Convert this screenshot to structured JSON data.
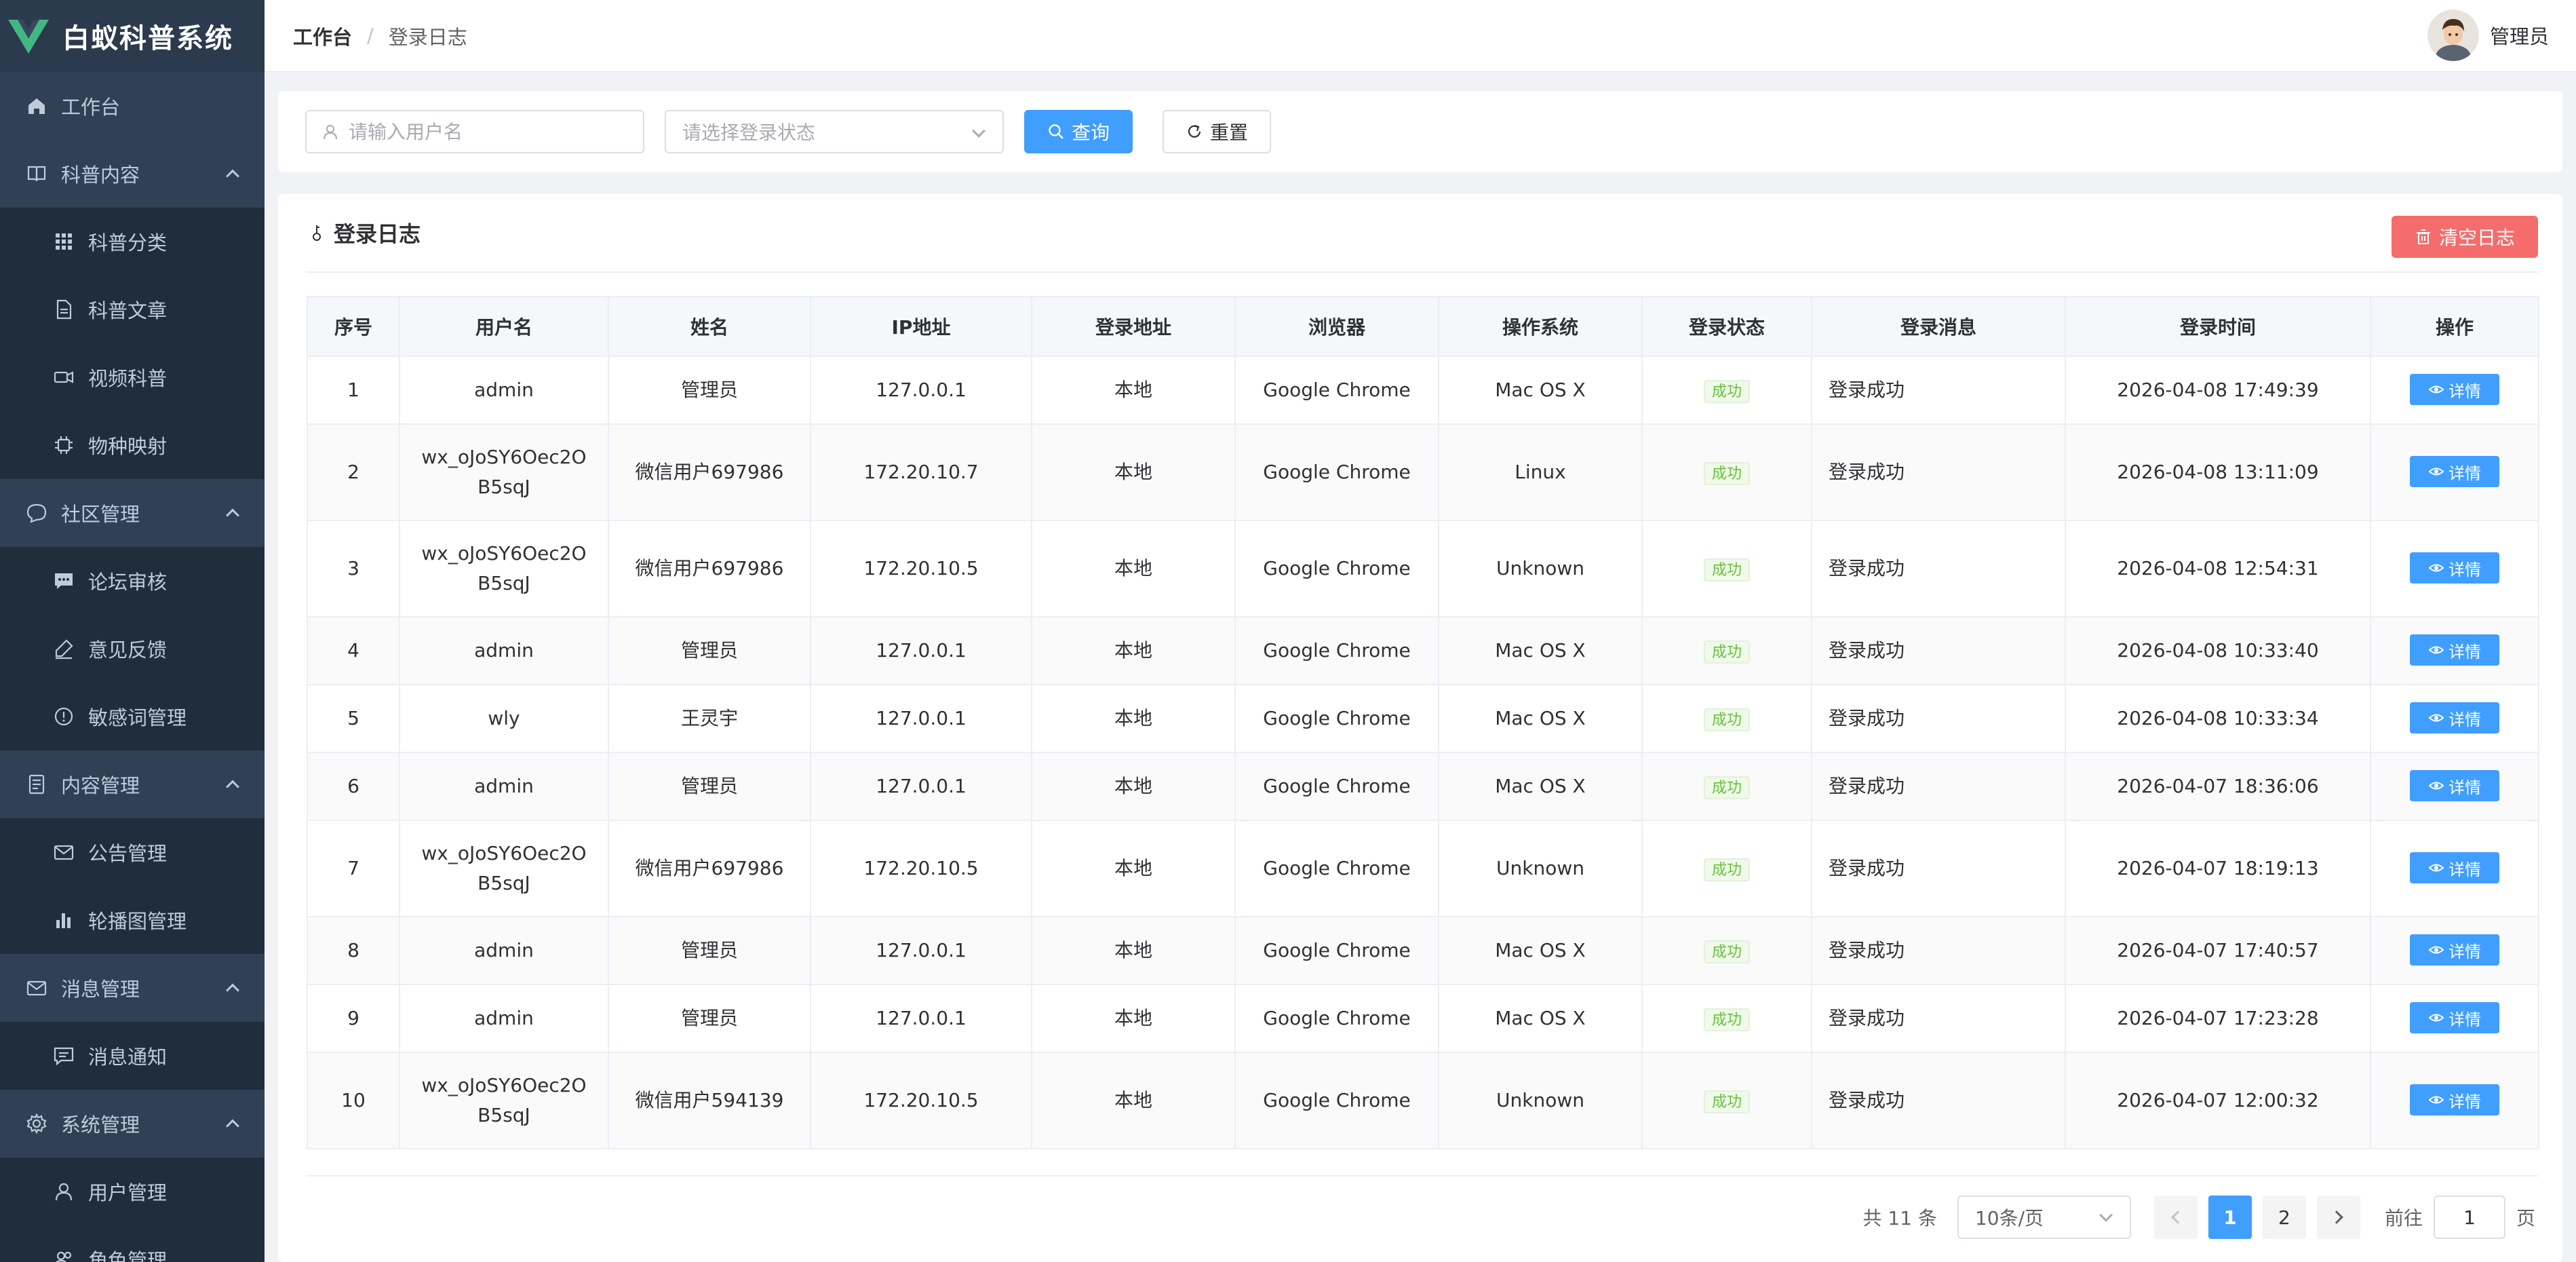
{
  "app": {
    "title": "白蚁科普系统",
    "brand_color": "#41b883"
  },
  "sidebar": {
    "items": [
      {
        "label": "工作台",
        "icon": "home-icon",
        "level": "top",
        "expandable": false
      },
      {
        "label": "科普内容",
        "icon": "book-icon",
        "level": "top",
        "expandable": true
      },
      {
        "label": "科普分类",
        "icon": "grid-icon",
        "level": "sub"
      },
      {
        "label": "科普文章",
        "icon": "document-icon",
        "level": "sub"
      },
      {
        "label": "视频科普",
        "icon": "video-camera-icon",
        "level": "sub"
      },
      {
        "label": "物种映射",
        "icon": "cpu-icon",
        "level": "sub"
      },
      {
        "label": "社区管理",
        "icon": "chat-bubble-icon",
        "level": "top",
        "expandable": true
      },
      {
        "label": "论坛审核",
        "icon": "chat-dots-icon",
        "level": "sub"
      },
      {
        "label": "意见反馈",
        "icon": "pen-icon",
        "level": "sub"
      },
      {
        "label": "敏感词管理",
        "icon": "warning-circle-icon",
        "level": "sub"
      },
      {
        "label": "内容管理",
        "icon": "tickets-icon",
        "level": "top",
        "expandable": true
      },
      {
        "label": "公告管理",
        "icon": "message-icon",
        "level": "sub"
      },
      {
        "label": "轮播图管理",
        "icon": "bar-chart-icon",
        "level": "sub"
      },
      {
        "label": "消息管理",
        "icon": "envelope-icon",
        "level": "top",
        "expandable": true
      },
      {
        "label": "消息通知",
        "icon": "chat-square-icon",
        "level": "sub"
      },
      {
        "label": "系统管理",
        "icon": "gear-icon",
        "level": "top",
        "expandable": true
      },
      {
        "label": "用户管理",
        "icon": "user-icon",
        "level": "sub"
      },
      {
        "label": "角色管理",
        "icon": "user-group-icon",
        "level": "sub"
      }
    ]
  },
  "header": {
    "breadcrumb_home": "工作台",
    "breadcrumb_sep": "/",
    "breadcrumb_current": "登录日志",
    "user_name": "管理员"
  },
  "search": {
    "username_placeholder": "请输入用户名",
    "status_placeholder": "请选择登录状态",
    "query_label": "查询",
    "reset_label": "重置"
  },
  "card": {
    "title": "登录日志",
    "clear_label": "清空日志"
  },
  "table": {
    "columns": [
      "序号",
      "用户名",
      "姓名",
      "IP地址",
      "登录地址",
      "浏览器",
      "操作系统",
      "登录状态",
      "登录消息",
      "登录时间",
      "操作"
    ],
    "rows": [
      {
        "no": "1",
        "username": "admin",
        "name": "管理员",
        "ip": "127.0.0.1",
        "location": "本地",
        "browser": "Google Chrome",
        "os": "Mac OS X",
        "status": "成功",
        "message": "登录成功",
        "time": "2026-04-08 17:49:39",
        "action": "详情"
      },
      {
        "no": "2",
        "username": "wx_oJoSY6Oec2OB5sqJ",
        "username_l1": "wx_oJoSY6Oec2O",
        "username_l2": "B5sqJ",
        "name": "微信用户697986",
        "ip": "172.20.10.7",
        "location": "本地",
        "browser": "Google Chrome",
        "os": "Linux",
        "status": "成功",
        "message": "登录成功",
        "time": "2026-04-08 13:11:09",
        "action": "详情"
      },
      {
        "no": "3",
        "username": "wx_oJoSY6Oec2OB5sqJ",
        "username_l1": "wx_oJoSY6Oec2O",
        "username_l2": "B5sqJ",
        "name": "微信用户697986",
        "ip": "172.20.10.5",
        "location": "本地",
        "browser": "Google Chrome",
        "os": "Unknown",
        "status": "成功",
        "message": "登录成功",
        "time": "2026-04-08 12:54:31",
        "action": "详情"
      },
      {
        "no": "4",
        "username": "admin",
        "name": "管理员",
        "ip": "127.0.0.1",
        "location": "本地",
        "browser": "Google Chrome",
        "os": "Mac OS X",
        "status": "成功",
        "message": "登录成功",
        "time": "2026-04-08 10:33:40",
        "action": "详情"
      },
      {
        "no": "5",
        "username": "wly",
        "name": "王灵宇",
        "ip": "127.0.0.1",
        "location": "本地",
        "browser": "Google Chrome",
        "os": "Mac OS X",
        "status": "成功",
        "message": "登录成功",
        "time": "2026-04-08 10:33:34",
        "action": "详情"
      },
      {
        "no": "6",
        "username": "admin",
        "name": "管理员",
        "ip": "127.0.0.1",
        "location": "本地",
        "browser": "Google Chrome",
        "os": "Mac OS X",
        "status": "成功",
        "message": "登录成功",
        "time": "2026-04-07 18:36:06",
        "action": "详情"
      },
      {
        "no": "7",
        "username": "wx_oJoSY6Oec2OB5sqJ",
        "username_l1": "wx_oJoSY6Oec2O",
        "username_l2": "B5sqJ",
        "name": "微信用户697986",
        "ip": "172.20.10.5",
        "location": "本地",
        "browser": "Google Chrome",
        "os": "Unknown",
        "status": "成功",
        "message": "登录成功",
        "time": "2026-04-07 18:19:13",
        "action": "详情"
      },
      {
        "no": "8",
        "username": "admin",
        "name": "管理员",
        "ip": "127.0.0.1",
        "location": "本地",
        "browser": "Google Chrome",
        "os": "Mac OS X",
        "status": "成功",
        "message": "登录成功",
        "time": "2026-04-07 17:40:57",
        "action": "详情"
      },
      {
        "no": "9",
        "username": "admin",
        "name": "管理员",
        "ip": "127.0.0.1",
        "location": "本地",
        "browser": "Google Chrome",
        "os": "Mac OS X",
        "status": "成功",
        "message": "登录成功",
        "time": "2026-04-07 17:23:28",
        "action": "详情"
      },
      {
        "no": "10",
        "username": "wx_oJoSY6Oec2OB5sqJ",
        "username_l1": "wx_oJoSY6Oec2O",
        "username_l2": "B5sqJ",
        "name": "微信用户594139",
        "ip": "172.20.10.5",
        "location": "本地",
        "browser": "Google Chrome",
        "os": "Unknown",
        "status": "成功",
        "message": "登录成功",
        "time": "2026-04-07 12:00:32",
        "action": "详情"
      }
    ]
  },
  "pagination": {
    "total_text": "共 11 条",
    "page_size": "10条/页",
    "pages": [
      "1",
      "2"
    ],
    "current_page": "1",
    "goto_label": "前往",
    "goto_value": "1",
    "page_suffix": "页"
  },
  "colors": {
    "sidebar_bg": "#304156",
    "primary": "#409eff",
    "danger": "#f56c6c",
    "success": "#67c23a"
  }
}
